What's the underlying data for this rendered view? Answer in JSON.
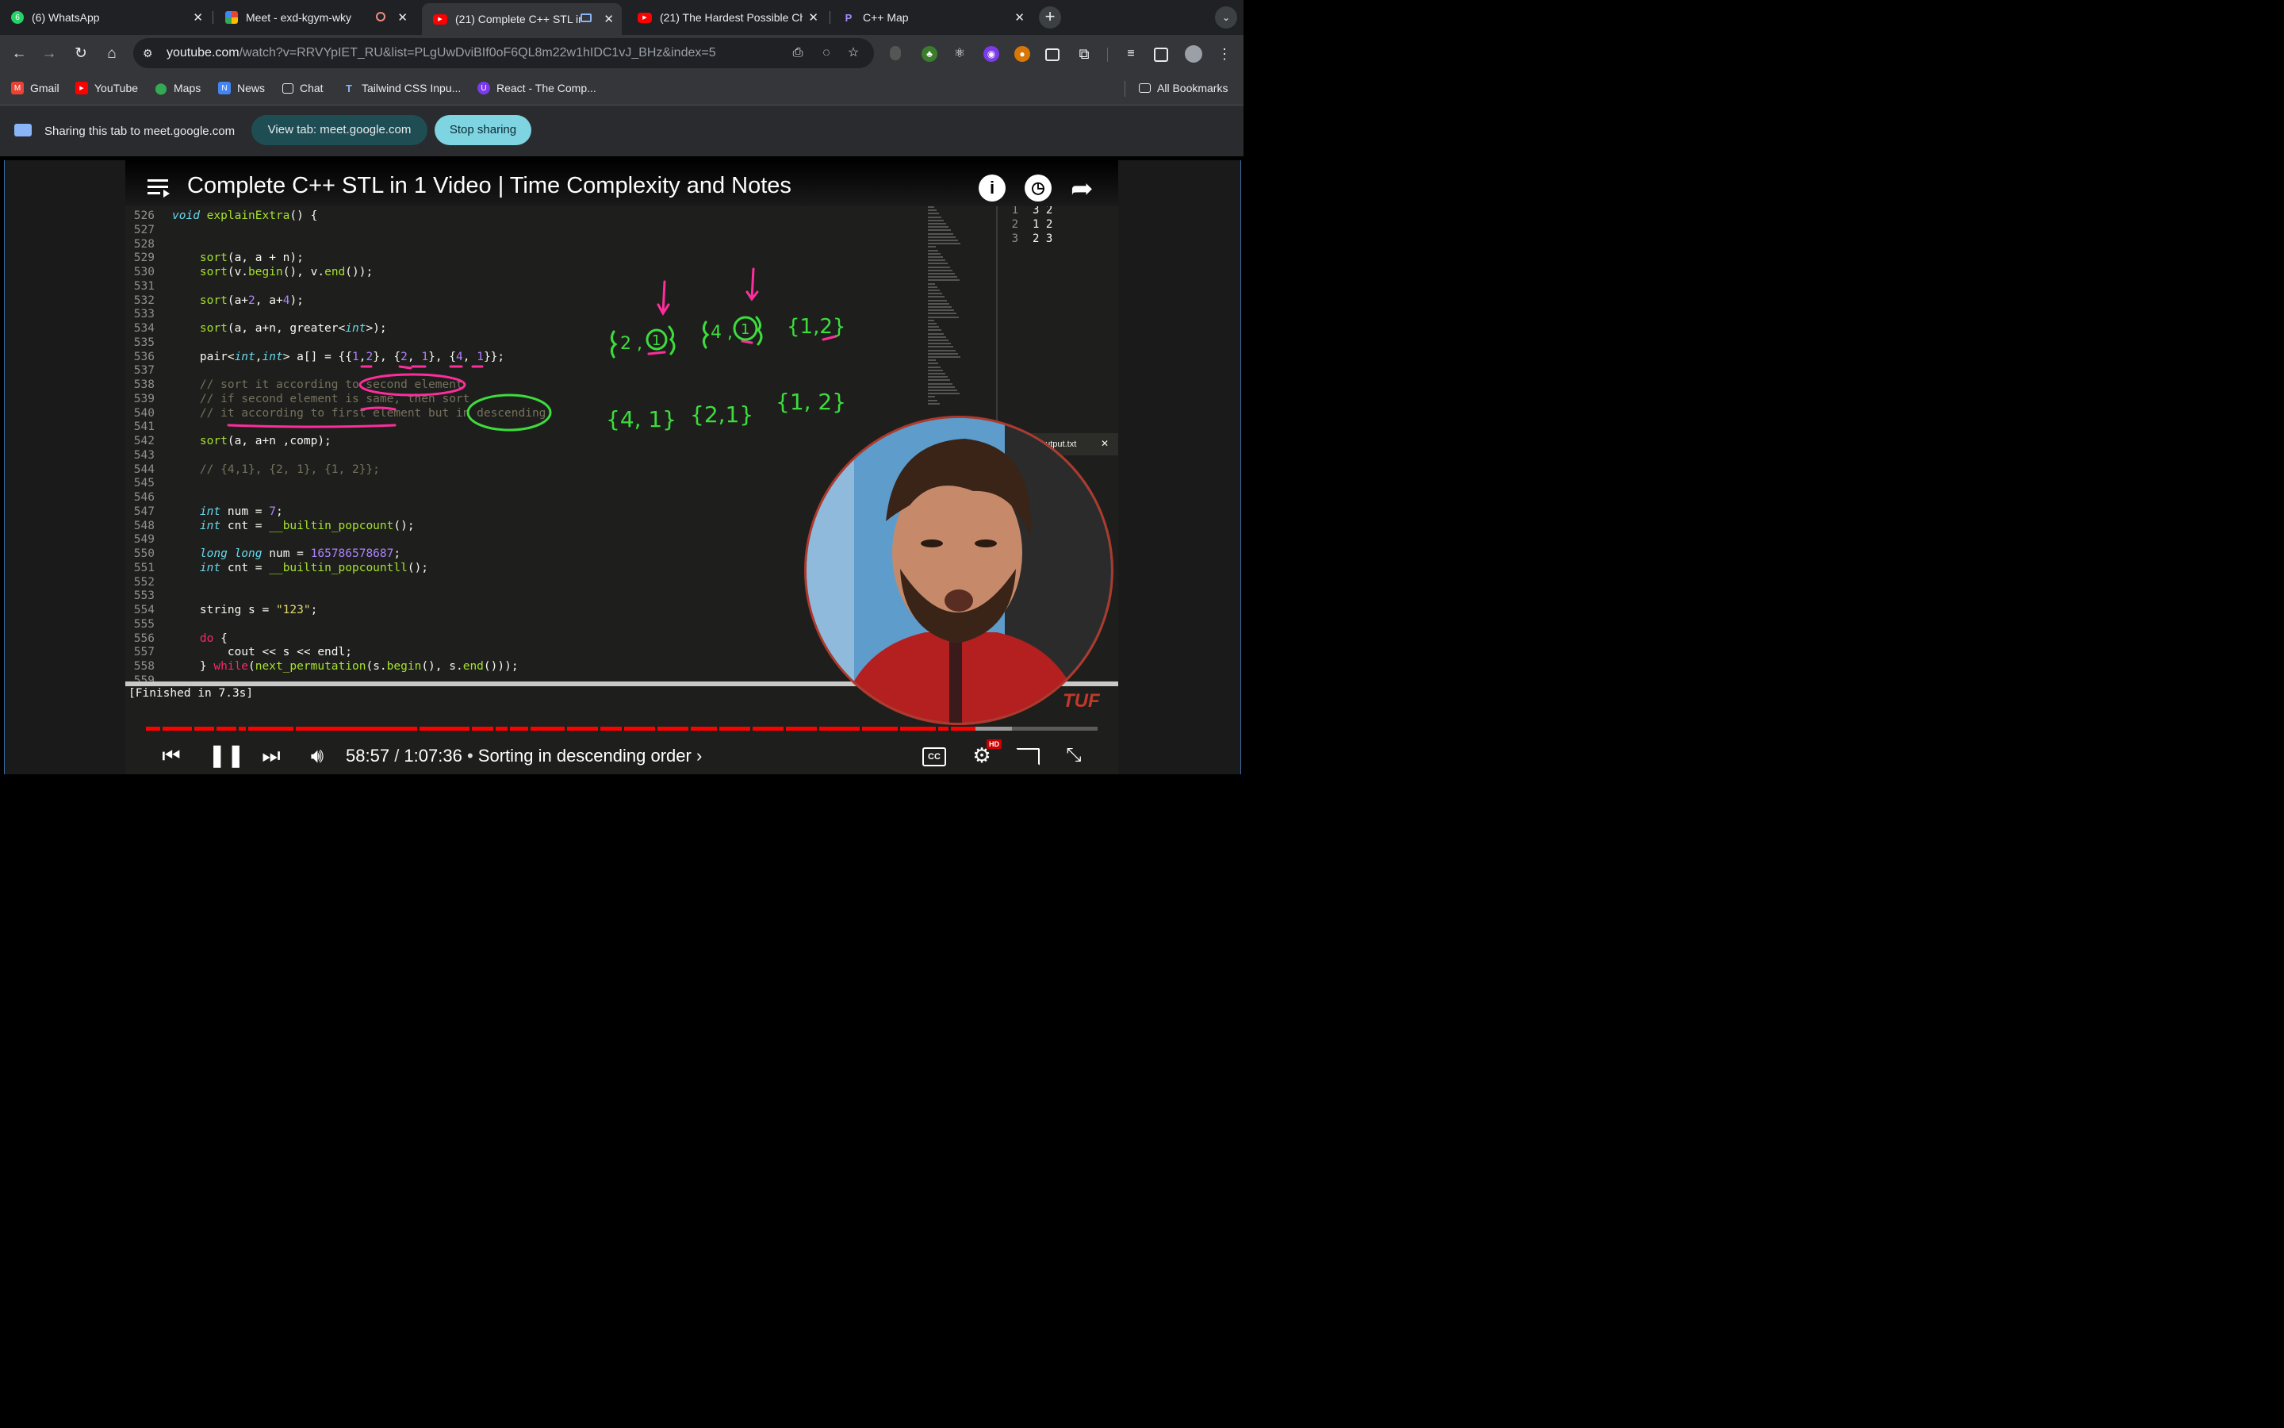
{
  "browser": {
    "tabs": [
      {
        "title": "(6) WhatsApp",
        "favicon": "whatsapp-icon",
        "badge": "6",
        "active": false
      },
      {
        "title": "Meet - exd-kgym-wky",
        "favicon": "meet-icon",
        "active": false
      },
      {
        "title": "(21) Complete C++ STL in",
        "favicon": "youtube-icon",
        "active": true
      },
      {
        "title": "(21) The Hardest Possible Ch",
        "favicon": "youtube-icon",
        "active": false
      },
      {
        "title": "C++ Map",
        "favicon": "perplexity-icon",
        "active": false
      }
    ],
    "url_host": "youtube.com",
    "url_path": "/watch?v=RRVYpIET_RU&list=PLgUwDviBIf0oF6QL8m22w1hIDC1vJ_BHz&index=5",
    "bookmarks": [
      "Gmail",
      "YouTube",
      "Maps",
      "News",
      "Chat",
      "Tailwind CSS Inpu...",
      "React - The Comp..."
    ],
    "all_bookmarks": "All Bookmarks"
  },
  "sharing": {
    "text": "Sharing this tab to meet.google.com",
    "view_tab": "View tab: meet.google.com",
    "stop": "Stop sharing"
  },
  "video": {
    "title": "Complete C++ STL in 1 Video | Time Complexity and Notes",
    "time_current": "58:57",
    "time_total": "1:07:36",
    "chapter": "Sorting in descending order",
    "progress_fraction": 0.872,
    "buffered_fraction": 0.91,
    "hd_label": "HD",
    "watermark": "TUF"
  },
  "editor": {
    "lines": [
      {
        "n": "526",
        "html": "<span class=\"kw\">void</span> <span class=\"fn\">explainExtra</span>() {"
      },
      {
        "n": "527",
        "html": ""
      },
      {
        "n": "528",
        "html": ""
      },
      {
        "n": "529",
        "html": "    <span class=\"fn\">sort</span>(a, a + n);"
      },
      {
        "n": "530",
        "html": "    <span class=\"fn\">sort</span>(v.<span class=\"fn\">begin</span>(), v.<span class=\"fn\">end</span>());"
      },
      {
        "n": "531",
        "html": ""
      },
      {
        "n": "532",
        "html": "    <span class=\"fn\">sort</span>(a+<span class=\"num\">2</span>, a+<span class=\"num\">4</span>);"
      },
      {
        "n": "533",
        "html": ""
      },
      {
        "n": "534",
        "html": "    <span class=\"fn\">sort</span>(a, a+n, greater&lt;<span class=\"kw\">int</span>&gt;);"
      },
      {
        "n": "535",
        "html": ""
      },
      {
        "n": "536",
        "html": "    pair&lt;<span class=\"kw\">int</span>,<span class=\"kw\">int</span>&gt; a[] = {{<span class=\"num\">1</span>,<span class=\"num\">2</span>}, {<span class=\"num\">2</span>, <span class=\"num\">1</span>}, {<span class=\"num\">4</span>, <span class=\"num\">1</span>}};"
      },
      {
        "n": "537",
        "html": ""
      },
      {
        "n": "538",
        "html": "    <span class=\"cm\">// sort it according to second element</span>"
      },
      {
        "n": "539",
        "html": "    <span class=\"cm\">// if second element is same, then sort</span>"
      },
      {
        "n": "540",
        "html": "    <span class=\"cm\">// it according to first element but in descending</span>"
      },
      {
        "n": "541",
        "html": ""
      },
      {
        "n": "542",
        "html": "    <span class=\"fn\">sort</span>(a, a+n ,comp);"
      },
      {
        "n": "543",
        "html": ""
      },
      {
        "n": "544",
        "html": "    <span class=\"cm\">// {4,1}, {2, 1}, {1, 2}};</span>"
      },
      {
        "n": "545",
        "html": ""
      },
      {
        "n": "546",
        "html": ""
      },
      {
        "n": "547",
        "html": "    <span class=\"kw\">int</span> num = <span class=\"num\">7</span>;"
      },
      {
        "n": "548",
        "html": "    <span class=\"kw\">int</span> cnt = <span class=\"fn\">__builtin_popcount</span>();"
      },
      {
        "n": "549",
        "html": ""
      },
      {
        "n": "550",
        "html": "    <span class=\"kw\">long long</span> num = <span class=\"num\">165786578687</span>;"
      },
      {
        "n": "551",
        "html": "    <span class=\"kw\">int</span> cnt = <span class=\"fn\">__builtin_popcountll</span>();"
      },
      {
        "n": "552",
        "html": ""
      },
      {
        "n": "553",
        "html": ""
      },
      {
        "n": "554",
        "html": "    string s = <span class=\"str\">\"123\"</span>;"
      },
      {
        "n": "555",
        "html": ""
      },
      {
        "n": "556",
        "html": "    <span class=\"red\">do</span> {"
      },
      {
        "n": "557",
        "html": "        cout &lt;&lt; s &lt;&lt; endl;"
      },
      {
        "n": "558",
        "html": "    } <span class=\"red\">while</span>(<span class=\"fn\">next_permutation</span>(s.<span class=\"fn\">begin</span>(), s.<span class=\"fn\">end</span>()));"
      },
      {
        "n": "559",
        "html": ""
      }
    ],
    "output_lines": [
      {
        "n": "1",
        "text": "3 2"
      },
      {
        "n": "2",
        "text": "1 2"
      },
      {
        "n": "3",
        "text": "2 3"
      }
    ],
    "output_tab": "output.txt",
    "build_status": "[Finished in 7.3s]"
  },
  "colors": {
    "accent": "#ff0000",
    "annot_green": "#3ddc3d",
    "annot_pink": "#ff2d9c"
  }
}
